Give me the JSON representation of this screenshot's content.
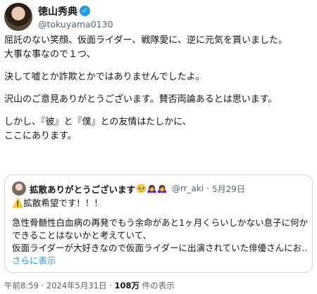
{
  "tweet": {
    "display_name": "徳山秀典",
    "handle": "@tokuyama0130",
    "lines": [
      "屈託のない笑顔、仮面ライダー、戦隊愛に、逆に元気を貰いました。",
      "大事な事なので１つ、",
      "決して嘘とか詐欺とかではありませんでしたよ。",
      "沢山のご意見ありがとうございます。賛否両論あるとは思います。",
      "しかし、『彼』と『僕』との友情はたしかに、",
      "ここにあります。"
    ]
  },
  "quote": {
    "display_name": "拡散ありがとうございます",
    "emojis": "🥺🙇‍♀️🙇‍♀️",
    "handle": "@rr_aki",
    "separator": "·",
    "date": "5月29日",
    "warn_icon": "⚠️",
    "first_line": "拡散希望です！！！",
    "lines": [
      "急性骨髄性白血病の再発でもう余命があと1ヶ月くらいしかない息子に何か",
      "できることはないかと考えていて、",
      "仮面ライダーが大好きなので仮面ライダーに出演されていた俳優さんにお…"
    ],
    "show_more": "さらに表示"
  },
  "footer": {
    "time_date": "午前8:59 · 2024年5月31日 · ",
    "views_count": "108万",
    "views_label": " 件の表示"
  },
  "colors": {
    "accent": "#1d9bf0",
    "muted": "#536471",
    "border": "#cfd9de"
  },
  "icons": {
    "verified": "verified-badge-icon",
    "warning": "warning-icon"
  }
}
